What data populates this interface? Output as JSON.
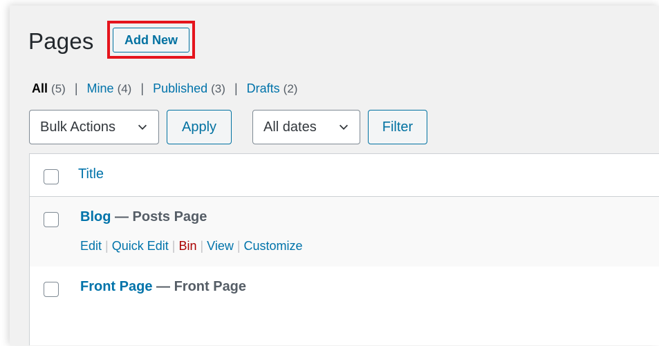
{
  "header": {
    "title": "Pages",
    "add_new_label": "Add New"
  },
  "filters": {
    "all_label": "All",
    "all_count": "(5)",
    "mine_label": "Mine",
    "mine_count": "(4)",
    "published_label": "Published",
    "published_count": "(3)",
    "drafts_label": "Drafts",
    "drafts_count": "(2)",
    "separator": "|"
  },
  "toolbar": {
    "bulk_actions_value": "Bulk Actions",
    "apply_label": "Apply",
    "dates_value": "All dates",
    "filter_label": "Filter"
  },
  "table": {
    "header_title": "Title",
    "rows": [
      {
        "title": "Blog",
        "state": "— Posts Page",
        "actions": [
          "Edit",
          "Quick Edit",
          "Bin",
          "View",
          "Customize"
        ]
      },
      {
        "title": "Front Page",
        "state": "— Front Page"
      }
    ]
  },
  "colors": {
    "link": "#0073aa",
    "highlight": "#e5141c",
    "bin": "#aa0000"
  }
}
